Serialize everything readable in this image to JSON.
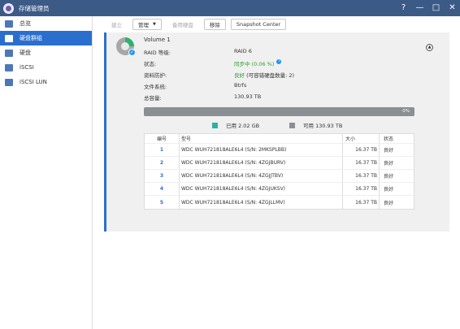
{
  "window": {
    "title": "存储管理员",
    "controls": [
      "?",
      "—",
      "□",
      "✕"
    ]
  },
  "sidebar": {
    "items": [
      {
        "label": "总览",
        "icon": "list-icon",
        "active": false
      },
      {
        "label": "硬盘群组",
        "icon": "list-icon",
        "active": true
      },
      {
        "label": "硬盘",
        "icon": "disk-icon",
        "active": false
      },
      {
        "label": "iSCSI",
        "icon": "iscsi-icon",
        "active": false
      },
      {
        "label": "iSCSI LUN",
        "icon": "lun-icon",
        "active": false
      }
    ]
  },
  "toolbar": {
    "create": "建立",
    "manage": "管理",
    "hot_spare": "备用硬盘",
    "remove": "移除",
    "snapshot": "Snapshot Center"
  },
  "volume": {
    "name": "Volume 1",
    "details": [
      {
        "label": "RAID 等级:",
        "value": "RAID 6",
        "style": "normal"
      },
      {
        "label": "状态:",
        "value": "同步中 (0.06 %)",
        "style": "green",
        "info": true
      },
      {
        "label": "资料防护:",
        "value_green": "良好",
        "value_rest": " (可容错硬盘数量: 2)",
        "style": "mixed"
      },
      {
        "label": "文件系统:",
        "value": "Btrfs",
        "style": "normal"
      },
      {
        "label": "总容量:",
        "value": "130.93 TB",
        "style": "normal"
      }
    ],
    "usage": {
      "percent_label": "0%",
      "used_fraction": 0.0,
      "used_label": "已用 2.02 GB",
      "free_label": "可用 130.93 TB",
      "used_color": "#2bb3a1",
      "free_color": "#8a8f94"
    }
  },
  "disks": {
    "headers": [
      "编号",
      "型号",
      "大小",
      "状态"
    ],
    "rows": [
      {
        "no": "1",
        "model": "WDC WUH721818ALE6L4 (S/N: 2MKSPLBB)",
        "size": "16.37 TB",
        "status": "良好"
      },
      {
        "no": "2",
        "model": "WDC WUH721818ALE6L4 (S/N: 4ZGJBURV)",
        "size": "16.37 TB",
        "status": "良好"
      },
      {
        "no": "3",
        "model": "WDC WUH721818ALE6L4 (S/N: 4ZGJJTBV)",
        "size": "16.37 TB",
        "status": "良好"
      },
      {
        "no": "4",
        "model": "WDC WUH721818ALE6L4 (S/N: 4ZGJUKSV)",
        "size": "16.37 TB",
        "status": "良好"
      },
      {
        "no": "5",
        "model": "WDC WUH721818ALE6L4 (S/N: 4ZGJLLMV)",
        "size": "16.37 TB",
        "status": "良好"
      }
    ]
  }
}
